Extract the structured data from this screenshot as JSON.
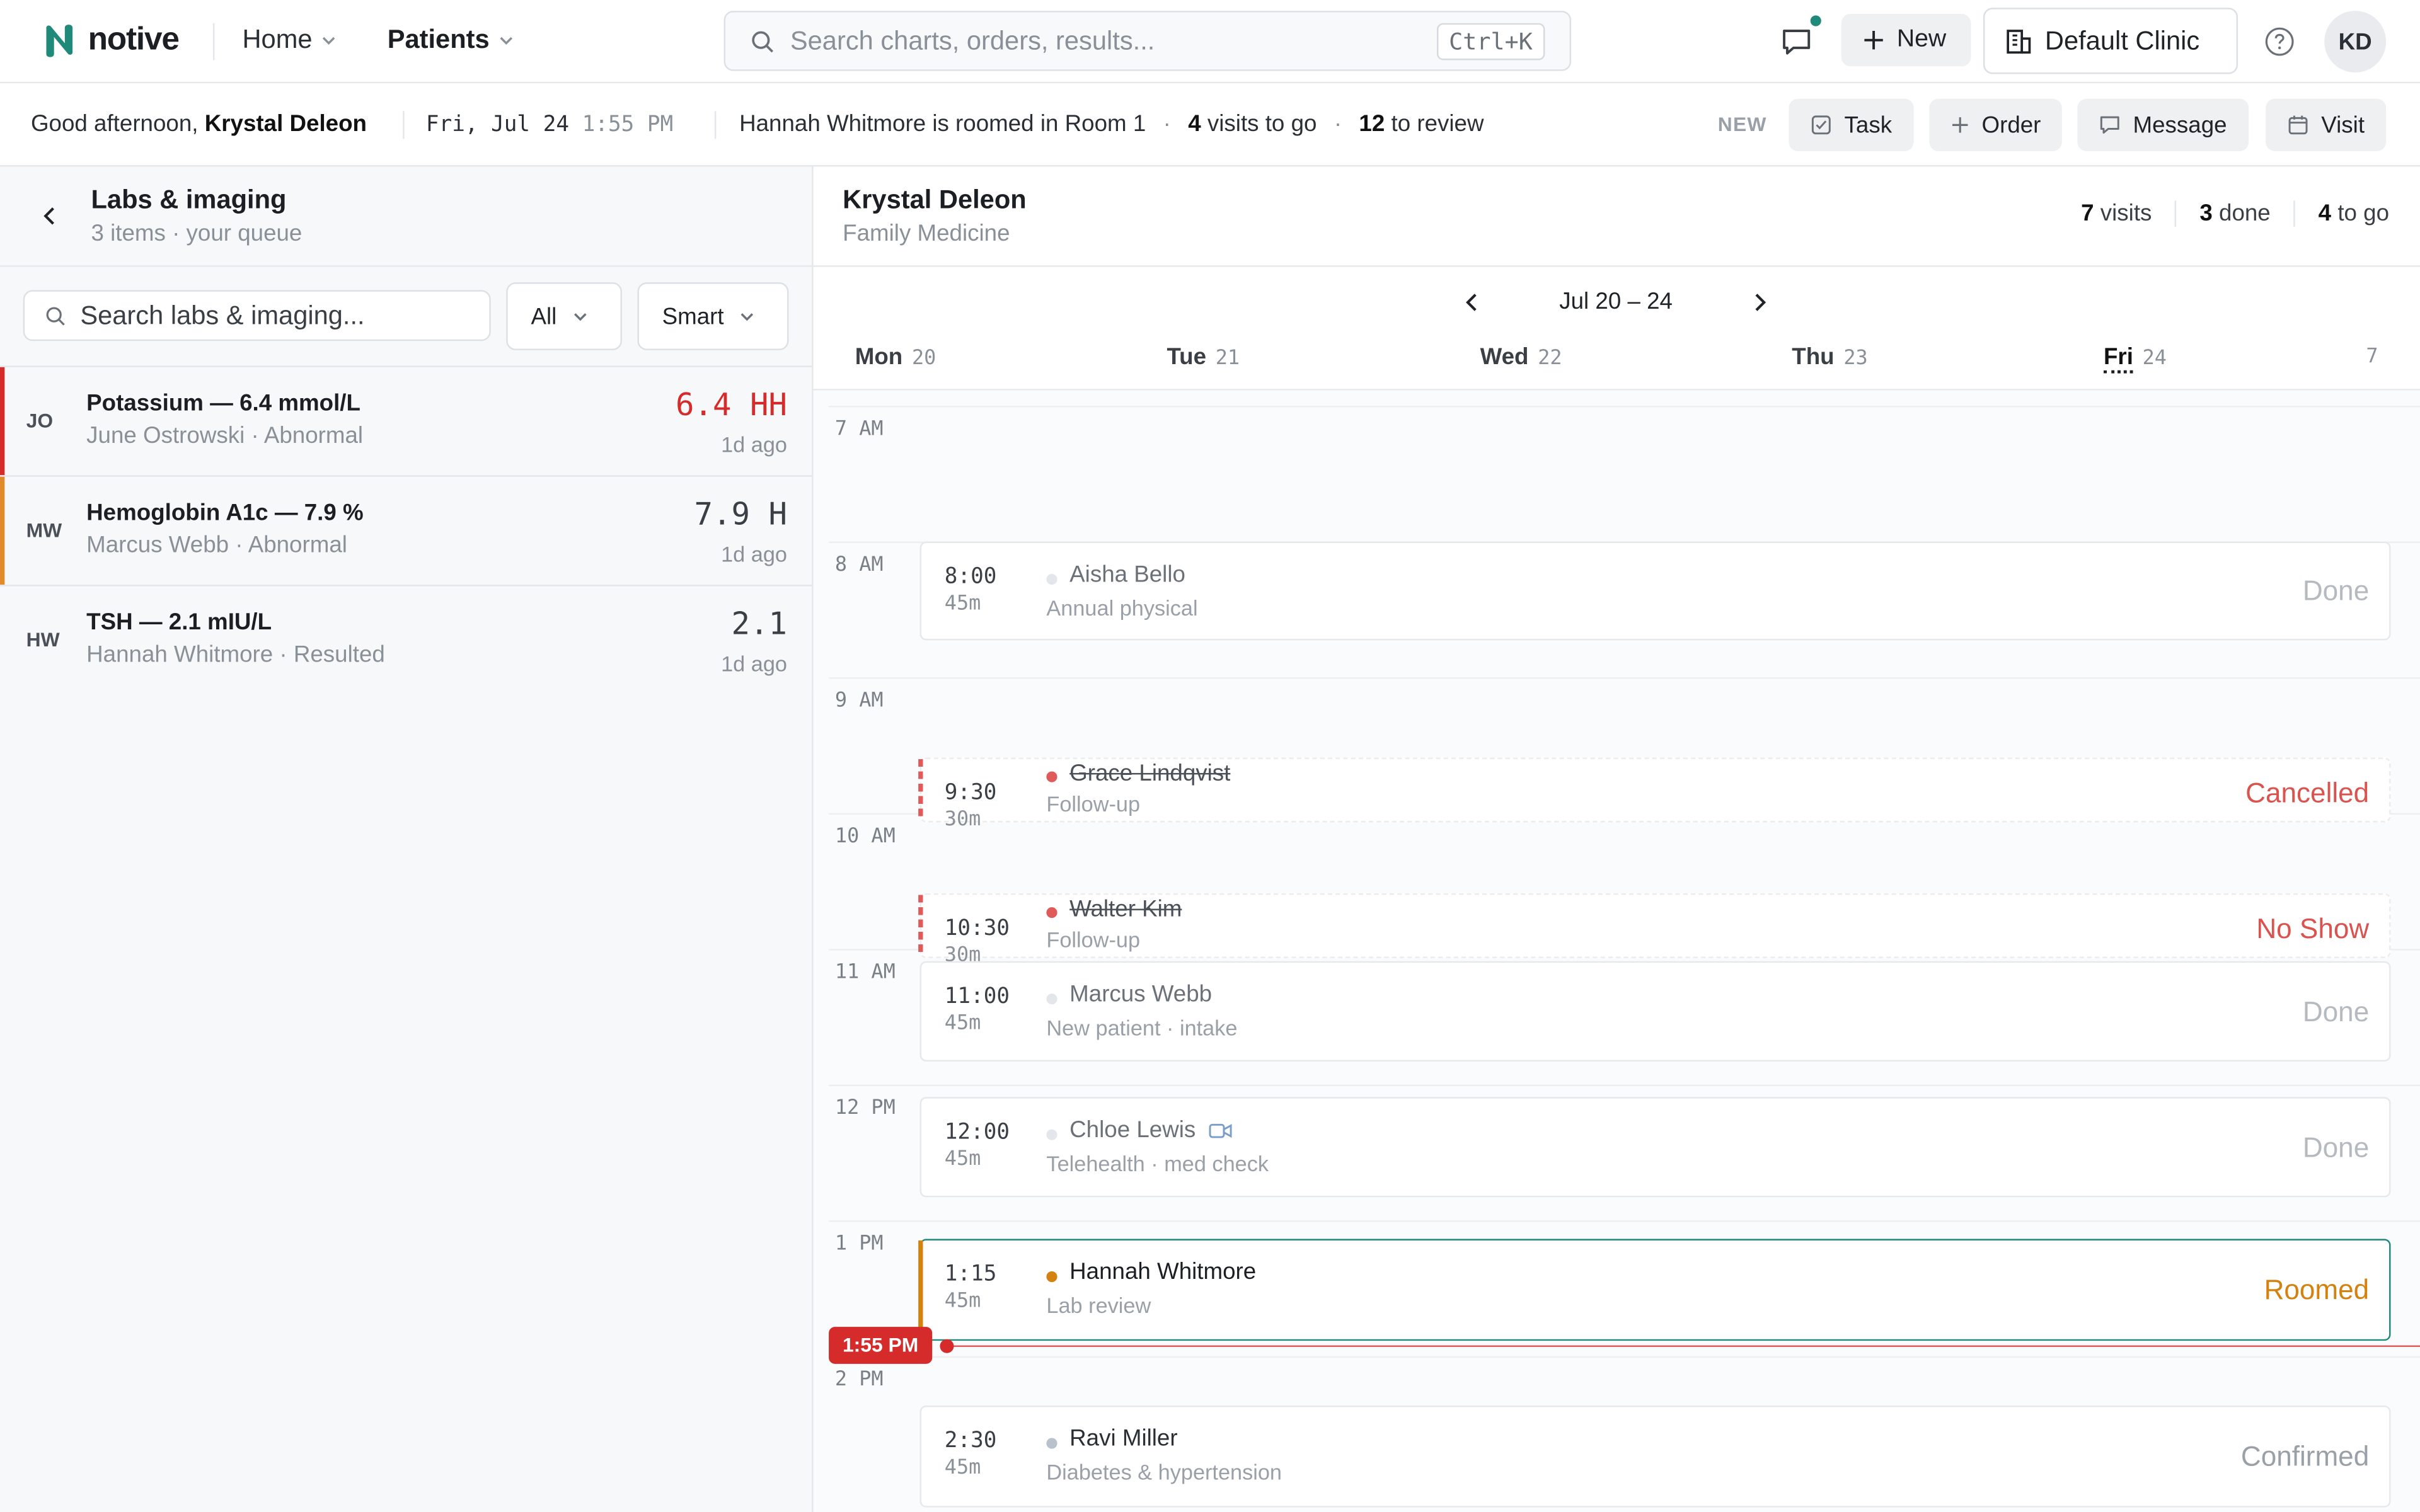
{
  "app": {
    "logo_text": "notive",
    "brand_color": "#1f8a7a"
  },
  "nav": {
    "home": "Home",
    "patients": "Patients"
  },
  "search": {
    "placeholder": "Search charts, orders, results...",
    "shortcut": "Ctrl+K"
  },
  "topbar": {
    "new_label": "New",
    "clinic_label": "Default Clinic",
    "avatar_initials": "KD",
    "icons": [
      "chat-icon",
      "plus-icon",
      "building-icon",
      "help-icon"
    ]
  },
  "subbar": {
    "greeting": "Good afternoon,",
    "user_name": "Krystal Deleon",
    "date": "Fri, Jul 24",
    "time": "1:55 PM",
    "roomed_msg": "Hannah Whitmore is roomed in Room 1",
    "visits_count": "4",
    "visits_text": "visits to go",
    "review_count": "12",
    "review_text": "to review",
    "new_label": "NEW",
    "actions": [
      "Task",
      "Order",
      "Message",
      "Visit"
    ]
  },
  "labs": {
    "title": "Labs & imaging",
    "subtitle": "3 items · your queue",
    "search_placeholder": "Search labs & imaging...",
    "filter_all": "All",
    "filter_smart": "Smart",
    "items": [
      {
        "initials": "JO",
        "name": "Potassium — 6.4 mmol/L",
        "meta": "June Ostrowski · Abnormal",
        "value": "6.4 HH",
        "ago": "1d ago",
        "flag_color": "#d62b2b"
      },
      {
        "initials": "MW",
        "name": "Hemoglobin A1c — 7.9 %",
        "meta": "Marcus Webb · Abnormal",
        "value": "7.9 H",
        "ago": "1d ago",
        "flag_color": "#e08a2a"
      },
      {
        "initials": "HW",
        "name": "TSH — 2.1 mIU/L",
        "meta": "Hannah Whitmore · Resulted",
        "value": "2.1",
        "ago": "1d ago",
        "flag_color": ""
      }
    ]
  },
  "schedule": {
    "provider": "Krystal Deleon",
    "specialty": "Family Medicine",
    "stats": [
      {
        "count": "7",
        "label": "visits"
      },
      {
        "count": "3",
        "label": "done"
      },
      {
        "count": "4",
        "label": "to go"
      }
    ],
    "week_label": "Jul 20 – 24",
    "days": [
      {
        "name": "Mon",
        "num": "20"
      },
      {
        "name": "Tue",
        "num": "21"
      },
      {
        "name": "Wed",
        "num": "22"
      },
      {
        "name": "Thu",
        "num": "23"
      },
      {
        "name": "Fri",
        "num": "24"
      }
    ],
    "week_count": "7",
    "hours": [
      "7 AM",
      "8 AM",
      "9 AM",
      "10 AM",
      "11 AM",
      "12 PM",
      "1 PM",
      "2 PM"
    ],
    "now_label": "1:55 PM",
    "appointments": [
      {
        "time": "8:00",
        "dur": "45m",
        "patient": "Aisha Bello",
        "reason": "Annual physical",
        "status": "Done",
        "status_color": "#b5bac0",
        "dot_color": "#e3e6ea"
      },
      {
        "time": "9:30",
        "dur": "30m",
        "patient": "Grace Lindqvist",
        "reason": "Follow-up",
        "status": "Cancelled",
        "status_color": "#d9534f",
        "dot_color": "#e05a5a"
      },
      {
        "time": "10:30",
        "dur": "30m",
        "patient": "Walter Kim",
        "reason": "Follow-up",
        "status": "No Show",
        "status_color": "#d9534f",
        "dot_color": "#e05a5a"
      },
      {
        "time": "11:00",
        "dur": "45m",
        "patient": "Marcus Webb",
        "reason": "New patient · intake",
        "status": "Done",
        "status_color": "#b5bac0",
        "dot_color": "#e3e6ea"
      },
      {
        "time": "12:00",
        "dur": "45m",
        "patient": "Chloe Lewis",
        "reason": "Telehealth · med check",
        "status": "Done",
        "status_color": "#b5bac0",
        "dot_color": "#e3e6ea"
      },
      {
        "time": "1:15",
        "dur": "45m",
        "patient": "Hannah Whitmore",
        "reason": "Lab review",
        "status": "Roomed",
        "status_color": "#d4820f",
        "dot_color": "#d4820f"
      },
      {
        "time": "2:30",
        "dur": "45m",
        "patient": "Ravi Miller",
        "reason": "Diabetes & hypertension",
        "status": "Confirmed",
        "status_color": "#9aa0a7",
        "dot_color": "#b9c2cc"
      }
    ]
  }
}
